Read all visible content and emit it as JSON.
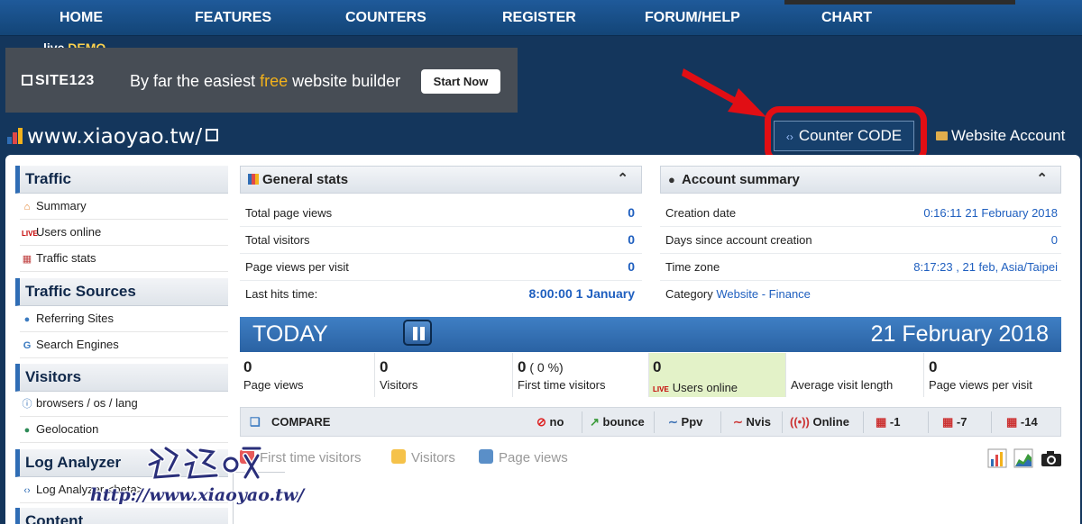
{
  "nav": {
    "items": [
      "HOME",
      "FEATURES",
      "COUNTERS",
      "REGISTER",
      "FORUM/HELP",
      "CHART"
    ]
  },
  "live_demo": {
    "text1": "live",
    "text2": "DEMO"
  },
  "ad": {
    "logo": "SITE123",
    "tag_before": "By far the easiest ",
    "tag_free": "free",
    "tag_after": " website builder",
    "button": "Start Now"
  },
  "site": {
    "title": "www.xiaoyao.tw/"
  },
  "buttons": {
    "counter_code": "Counter CODE",
    "website_account": "Website Account"
  },
  "sidebar": {
    "sections": [
      {
        "title": "Traffic",
        "items": [
          "Summary",
          "Users online",
          "Traffic stats"
        ]
      },
      {
        "title": "Traffic Sources",
        "items": [
          "Referring Sites",
          "Search Engines"
        ]
      },
      {
        "title": "Visitors",
        "items": [
          "browsers / os / lang",
          "Geolocation"
        ]
      },
      {
        "title": "Log Analyzer",
        "items": [
          "Log Analyzer <beta>"
        ]
      },
      {
        "title": "Content",
        "items": []
      }
    ]
  },
  "general_stats": {
    "title": "General stats",
    "rows": [
      {
        "label": "Total page views",
        "value": "0"
      },
      {
        "label": "Total visitors",
        "value": "0"
      },
      {
        "label": "Page views per visit",
        "value": "0"
      },
      {
        "label": "Last hits time:",
        "value": "8:00:00 1 January"
      }
    ]
  },
  "account_summary": {
    "title": "Account summary",
    "rows": [
      {
        "label": "Creation date",
        "value": "0:16:11 21 February 2018"
      },
      {
        "label": "Days since account creation",
        "value": "0"
      },
      {
        "label": "Time zone",
        "value": "8:17:23 , 21 feb, Asia/Taipei"
      },
      {
        "label": "Category",
        "value": "Website - Finance"
      }
    ]
  },
  "today": {
    "label": "TODAY",
    "date": "21 February 2018",
    "stats": [
      {
        "value": "0",
        "label": "Page views"
      },
      {
        "value": "0",
        "label": "Visitors"
      },
      {
        "value": "0",
        "pct": " ( 0 %)",
        "label": "First time visitors"
      },
      {
        "value": "0",
        "label": "Users online",
        "live": "LIVE"
      },
      {
        "value": "",
        "label": "Average visit length"
      },
      {
        "value": "0",
        "label": "Page views per visit"
      }
    ]
  },
  "compare": {
    "title": "COMPARE",
    "items": [
      "no",
      "bounce",
      "Ppv",
      "Nvis",
      "Online",
      "-1",
      "-7",
      "-14"
    ]
  },
  "legend": {
    "items": [
      {
        "label": "First time visitors",
        "color": "#e85a5a"
      },
      {
        "label": "Visitors",
        "color": "#f5c24a"
      },
      {
        "label": "Page views",
        "color": "#5a8fc8"
      }
    ]
  },
  "colors": {
    "accent": "#1f5fbf",
    "nav": "#1f5a9a",
    "highlight": "#e10e14",
    "online_cell": "#e3f2c8"
  },
  "watermark": {
    "url": "http://www.xiaoyao.tw/"
  }
}
